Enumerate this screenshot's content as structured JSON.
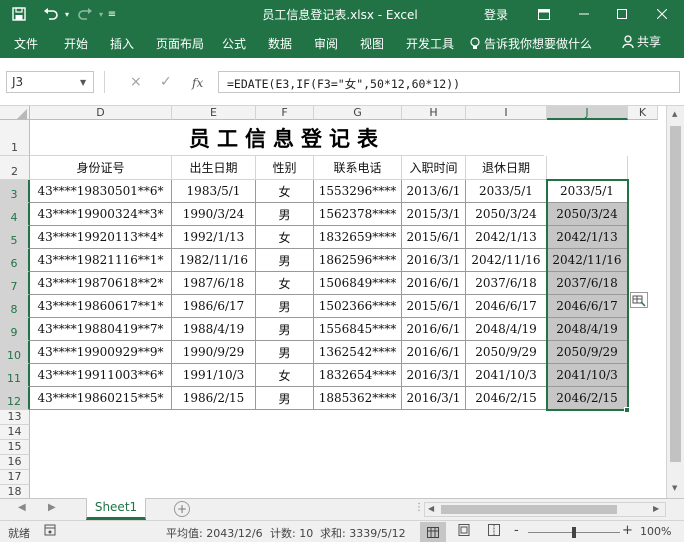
{
  "window": {
    "title": "员工信息登记表.xlsx - Excel",
    "signin": "登录",
    "tell_me": "告诉我你想要做什么",
    "share": "共享",
    "colors": {
      "accent": "#217346",
      "selection_fill": "#c6c6c6"
    }
  },
  "ribbon_tabs": [
    "文件",
    "开始",
    "插入",
    "页面布局",
    "公式",
    "数据",
    "审阅",
    "视图",
    "开发工具"
  ],
  "formula_bar": {
    "name_box": "J3",
    "formula": "=EDATE(E3,IF(F3=\"女\",50*12,60*12))",
    "cancel_icon": "×",
    "enter_icon": "✓",
    "fx_label": "fx"
  },
  "sheet": {
    "columns": [
      "D",
      "E",
      "F",
      "G",
      "H",
      "I",
      "J",
      "K"
    ],
    "rows": [
      "1",
      "2",
      "3",
      "4",
      "5",
      "6",
      "7",
      "8",
      "9",
      "10",
      "11",
      "12",
      "13",
      "14",
      "15",
      "16",
      "17",
      "18"
    ],
    "title": "员工信息登记表",
    "headers": [
      "身份证号",
      "出生日期",
      "性别",
      "联系电话",
      "入职时间",
      "退休日期",
      ""
    ],
    "data": [
      [
        "43****19830501**6*",
        "1983/5/1",
        "女",
        "1553296****",
        "2013/6/1",
        "2033/5/1",
        "2033/5/1"
      ],
      [
        "43****19900324**3*",
        "1990/3/24",
        "男",
        "1562378****",
        "2015/3/1",
        "2050/3/24",
        "2050/3/24"
      ],
      [
        "43****19920113**4*",
        "1992/1/13",
        "女",
        "1832659****",
        "2015/6/1",
        "2042/1/13",
        "2042/1/13"
      ],
      [
        "43****19821116**1*",
        "1982/11/16",
        "男",
        "1862596****",
        "2016/3/1",
        "2042/11/16",
        "2042/11/16"
      ],
      [
        "43****19870618**2*",
        "1987/6/18",
        "女",
        "1506849****",
        "2016/6/1",
        "2037/6/18",
        "2037/6/18"
      ],
      [
        "43****19860617**1*",
        "1986/6/17",
        "男",
        "1502366****",
        "2015/6/1",
        "2046/6/17",
        "2046/6/17"
      ],
      [
        "43****19880419**7*",
        "1988/4/19",
        "男",
        "1556845****",
        "2016/6/1",
        "2048/4/19",
        "2048/4/19"
      ],
      [
        "43****19900929**9*",
        "1990/9/29",
        "男",
        "1362542****",
        "2016/6/1",
        "2050/9/29",
        "2050/9/29"
      ],
      [
        "43****19911003**6*",
        "1991/10/3",
        "女",
        "1832654****",
        "2016/3/1",
        "2041/10/3",
        "2041/10/3"
      ],
      [
        "43****19860215**5*",
        "1986/2/15",
        "男",
        "1885362****",
        "2016/3/1",
        "2046/2/15",
        "2046/2/15"
      ]
    ]
  },
  "sheet_tabs": {
    "active": "Sheet1",
    "add": "+"
  },
  "status": {
    "ready": "就绪",
    "average": "平均值: 2043/12/6",
    "count": "计数: 10",
    "sum": "求和: 3339/5/12",
    "zoom": "100%",
    "zoom_minus": "-",
    "zoom_plus": "+"
  }
}
